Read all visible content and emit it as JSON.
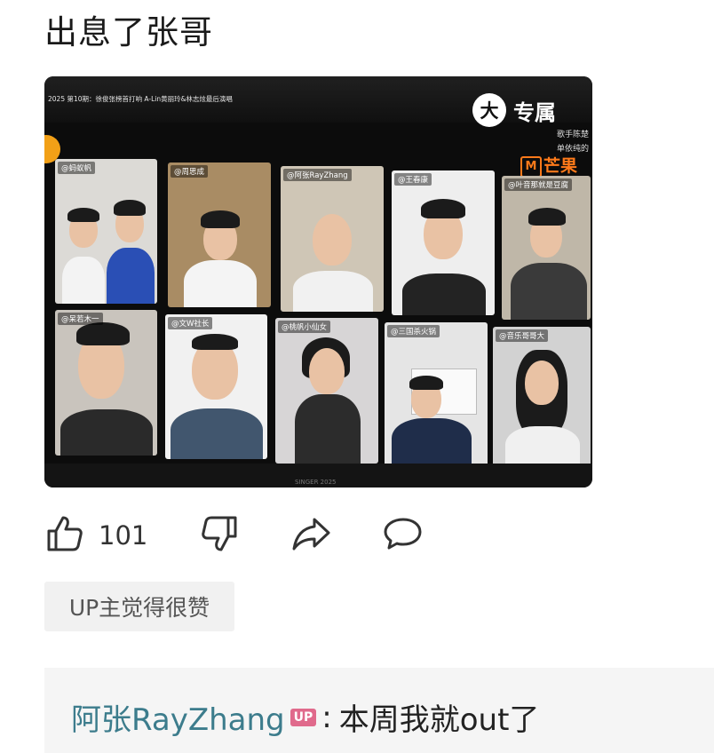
{
  "post": {
    "title": "出息了张哥"
  },
  "photo": {
    "caption": "2025 第10期：徐俊张榜首打响 A-Lin黄丽玲&林志炫最后演唱",
    "badge_circle": "大",
    "badge_text": "专属",
    "side_note_1": "歌手陈楚",
    "side_note_2": "单依纯的",
    "brand": "芒果",
    "brand_mark": "M",
    "footer": "SINGER 2025",
    "tiles": [
      {
        "label": "@蚂蚁帆"
      },
      {
        "label": "@周思成"
      },
      {
        "label": "@阿张RayZhang"
      },
      {
        "label": "@王春康"
      },
      {
        "label": "@叶音那就是豆腐"
      },
      {
        "label": "@呆若木一"
      },
      {
        "label": "@文W社长"
      },
      {
        "label": "@桃帆小仙女"
      },
      {
        "label": "@三国杀火锅"
      },
      {
        "label": "@音乐哥哥大"
      }
    ]
  },
  "actions": {
    "like_count": "101",
    "colors": {
      "icon": "#333333"
    }
  },
  "chip": {
    "label": "UP主觉得很赞"
  },
  "reply": {
    "author": "阿张RayZhang",
    "tag": "UP",
    "separator": ":",
    "text": "本周我就out了",
    "colors": {
      "author": "#3c7c8c",
      "tag_bg": "#e06a8c"
    }
  }
}
